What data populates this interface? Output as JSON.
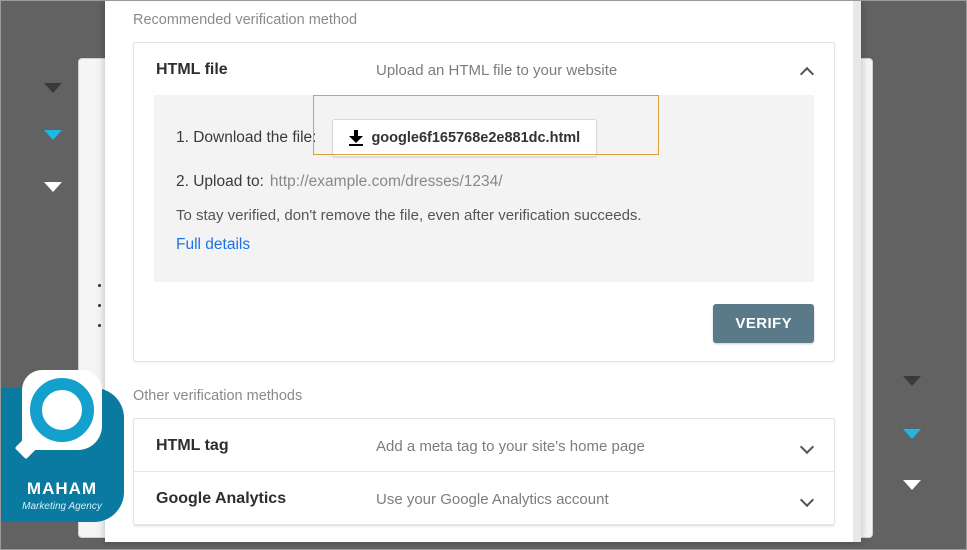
{
  "section_recommended": "Recommended verification method",
  "section_other": "Other verification methods",
  "recommended": {
    "title": "HTML file",
    "desc": "Upload an HTML file to your website",
    "step1_label": "1. Download the file:",
    "download_filename": "google6f165768e2e881dc.html",
    "step2_label": "2. Upload to:",
    "step2_url": "http://example.com/dresses/1234/",
    "note": "To stay verified, don't remove the file, even after verification succeeds.",
    "full_details": "Full details",
    "verify": "VERIFY"
  },
  "other": [
    {
      "title": "HTML tag",
      "desc": "Add a meta tag to your site's home page"
    },
    {
      "title": "Google Analytics",
      "desc": "Use your Google Analytics account"
    }
  ],
  "logo": {
    "name": "MAHAM",
    "sub": "Marketing Agency"
  }
}
